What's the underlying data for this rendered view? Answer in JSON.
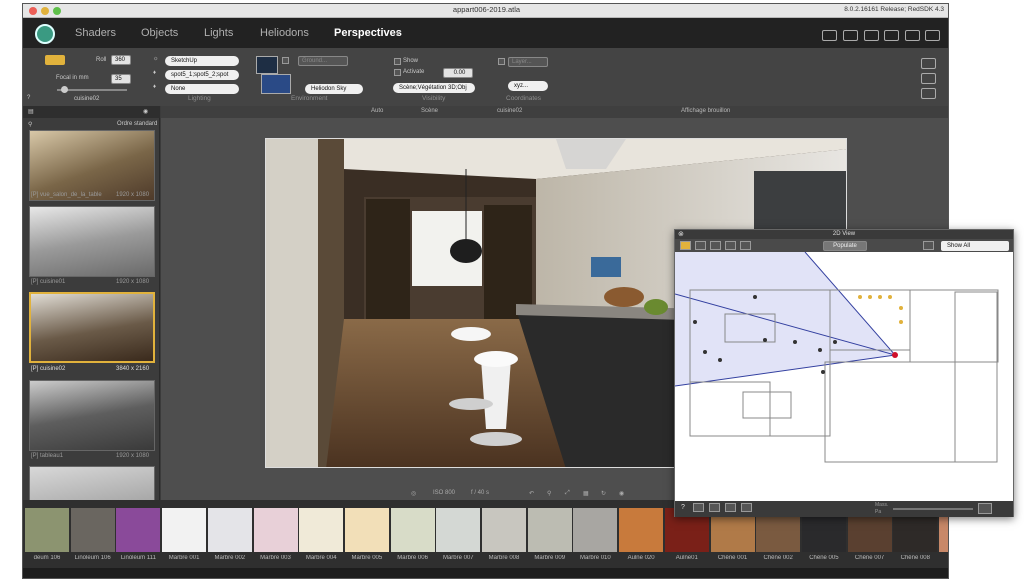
{
  "titlebar": {
    "title": "appart006-2019.atla",
    "version": "8.0.2.16161 Release; RedSDK 4.3"
  },
  "menu": {
    "tabs": [
      "Shaders",
      "Objects",
      "Lights",
      "Heliodons",
      "Perspectives"
    ],
    "active": "Perspectives"
  },
  "props": {
    "roll_label": "Roll",
    "roll_value": "360",
    "focal_label": "Focal in mm",
    "focal_value": "35",
    "help": "?",
    "view_name": "cuisine02",
    "lighting_values": [
      "SketchUp",
      "spot5_1;spot5_2;spot",
      "None"
    ],
    "ground_placeholder": "Ground...",
    "environment_value": "Heliodon Sky",
    "show_label": "Show",
    "activate_label": "Activate",
    "activate_value": "0.00",
    "visibility_value": "Scène;Végétation 3D;Obj",
    "layer_placeholder": "Layer...",
    "xyz_label": "xyz...",
    "sections": [
      "Lighting",
      "Environment",
      "Visibility",
      "Coordinates"
    ]
  },
  "sidebar": {
    "sort_label": "Ordre standard",
    "items": [
      {
        "name": "[P] vue_salon_de_la_table",
        "res": "1920 x 1080"
      },
      {
        "name": "[P] cuisine01",
        "res": "1920 x 1080"
      },
      {
        "name": "[P] cuisine02",
        "res": "3840 x 2160",
        "selected": true
      },
      {
        "name": "[P] tableau1",
        "res": "1920 x 1080"
      },
      {
        "name": "",
        "res": ""
      }
    ]
  },
  "viewtoolbar": {
    "auto": "Auto",
    "scene": "Scène",
    "view": "cuisine02",
    "draft": "Affichage brouillon"
  },
  "bottom": {
    "iso": "ISO 800",
    "fstop": "f / 40 s"
  },
  "panel2d": {
    "title": "2D View",
    "populate": "Populate",
    "show": "Show All",
    "help": "?",
    "scale_label": "Mass.",
    "scale_value": "Pa"
  },
  "materials": [
    {
      "name": "deum 106",
      "color": "#8c9470"
    },
    {
      "name": "Linoleum 106",
      "color": "#6a6660"
    },
    {
      "name": "Linoleum 111",
      "color": "#8a4a9a"
    },
    {
      "name": "Marbre 001",
      "color": "#f2f2f2"
    },
    {
      "name": "Marbre 002",
      "color": "#e4e4e8"
    },
    {
      "name": "Marbre 003",
      "color": "#e8d0d8"
    },
    {
      "name": "Marbre 004",
      "color": "#f0ead8"
    },
    {
      "name": "Marbre 005",
      "color": "#f2dfb8"
    },
    {
      "name": "Marbre 006",
      "color": "#d8dcc8"
    },
    {
      "name": "Marbre 007",
      "color": "#d4d8d4"
    },
    {
      "name": "Marbre 008",
      "color": "#c8c6bf"
    },
    {
      "name": "Marbre 009",
      "color": "#bcbcb2"
    },
    {
      "name": "Marbre 010",
      "color": "#a8a6a2"
    },
    {
      "name": "Aulne 020",
      "color": "#c87a3c"
    },
    {
      "name": "Aulne01",
      "color": "#7a2018"
    },
    {
      "name": "Chêne 001",
      "color": "#b07a48"
    },
    {
      "name": "Chêne 002",
      "color": "#7a5a40"
    },
    {
      "name": "Chêne 005",
      "color": "#2a2a2c"
    },
    {
      "name": "Chêne 007",
      "color": "#5a4030"
    },
    {
      "name": "Chêne 008",
      "color": "#2e2a28"
    },
    {
      "name": "Parqu",
      "color": "#c88868"
    }
  ]
}
